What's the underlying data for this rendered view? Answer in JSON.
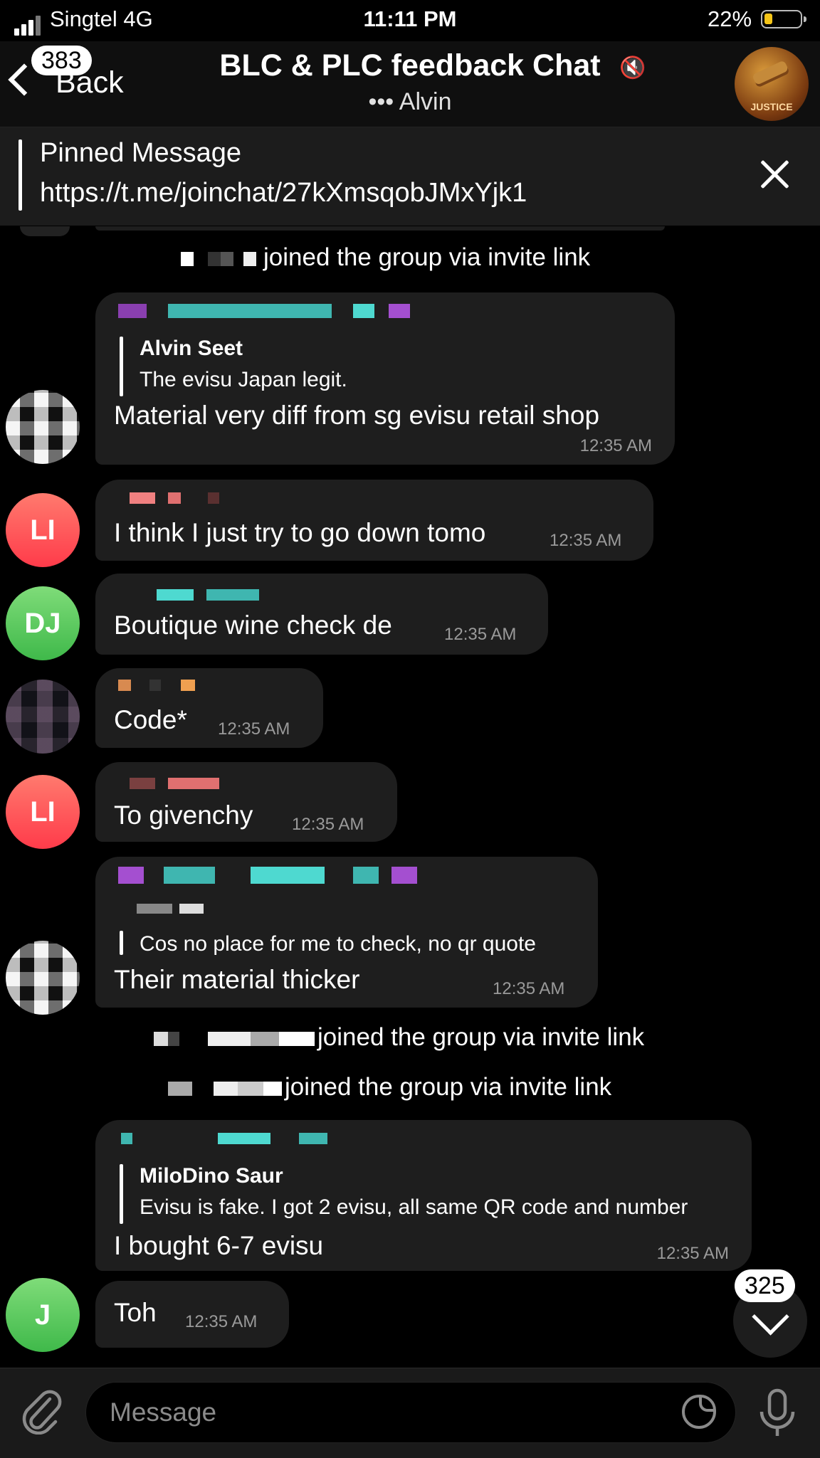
{
  "status_bar": {
    "carrier": "Singtel  4G",
    "time": "11:11 PM",
    "battery": "22%",
    "battery_level": 0.22
  },
  "header": {
    "back_label": "Back",
    "back_badge": "383",
    "title": "BLC & PLC feedback Chat",
    "subtitle": "••• Alvin",
    "mute_icon": "muted-speaker-icon",
    "avatar_text": "JUSTICE"
  },
  "pinned": {
    "title": "Pinned Message",
    "text": "https://t.me/joinchat/27kXmsqobJMxYjk1"
  },
  "messages": [
    {
      "type": "service",
      "text": "joined the group via invite link"
    },
    {
      "type": "message",
      "reply_name": "Alvin Seet",
      "reply_text": "The evisu Japan legit.",
      "text": "Material very diff from sg evisu retail shop",
      "time": "12:35 AM"
    },
    {
      "type": "message",
      "avatar": "LI",
      "text": "I think I just try to go down tomo",
      "time": "12:35 AM"
    },
    {
      "type": "message",
      "avatar": "DJ",
      "text": "Boutique wine check de",
      "time": "12:35 AM"
    },
    {
      "type": "message",
      "text": "Code*",
      "time": "12:35 AM"
    },
    {
      "type": "message",
      "avatar": "LI",
      "text": "To givenchy",
      "time": "12:35 AM"
    },
    {
      "type": "message",
      "reply_text": "Cos no place for me to check, no qr quote",
      "text": "Their material thicker",
      "time": "12:35 AM"
    },
    {
      "type": "service",
      "text": "joined the group via invite link"
    },
    {
      "type": "service",
      "text": "joined the group via invite link"
    },
    {
      "type": "message",
      "reply_name": "MiloDino Saur",
      "reply_text": "Evisu is fake. I got 2 evisu, all same QR code and number",
      "text": "I bought 6-7 evisu",
      "time": "12:35 AM"
    },
    {
      "type": "message",
      "avatar": "J",
      "text": "Toh",
      "time": "12:35 AM"
    }
  ],
  "scroll_down_badge": "325",
  "input": {
    "placeholder": "Message"
  }
}
